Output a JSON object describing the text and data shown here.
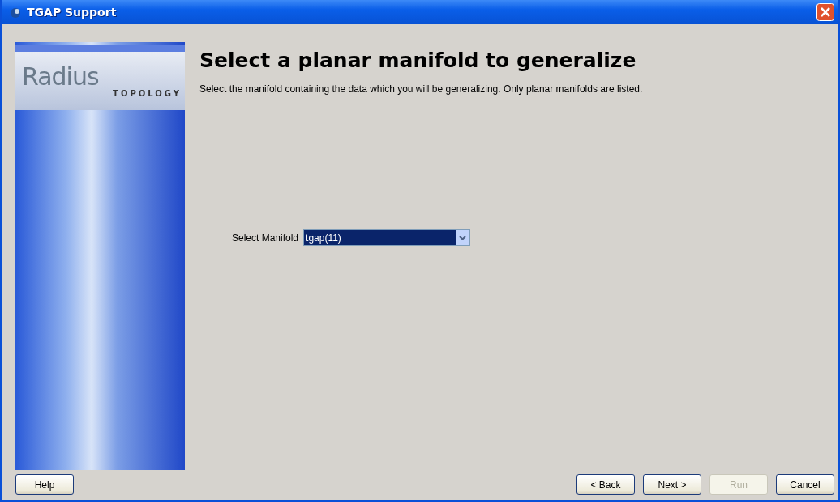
{
  "window": {
    "title": "TGAP Support"
  },
  "logo": {
    "name": "Radius",
    "subtitle": "TOPOLOGY"
  },
  "heading": "Select a planar manifold to generalize",
  "description": "Select the manifold containing the data which you will be generalizing. Only planar manifolds are listed.",
  "manifold_select": {
    "label": "Select Manifold",
    "value": "tgap(11)"
  },
  "buttons": [
    {
      "label": "Help",
      "disabled": false
    },
    {
      "label": "< Back",
      "disabled": false
    },
    {
      "label": "Next >",
      "disabled": false
    },
    {
      "label": "Run",
      "disabled": true
    },
    {
      "label": "Cancel",
      "disabled": false
    }
  ]
}
